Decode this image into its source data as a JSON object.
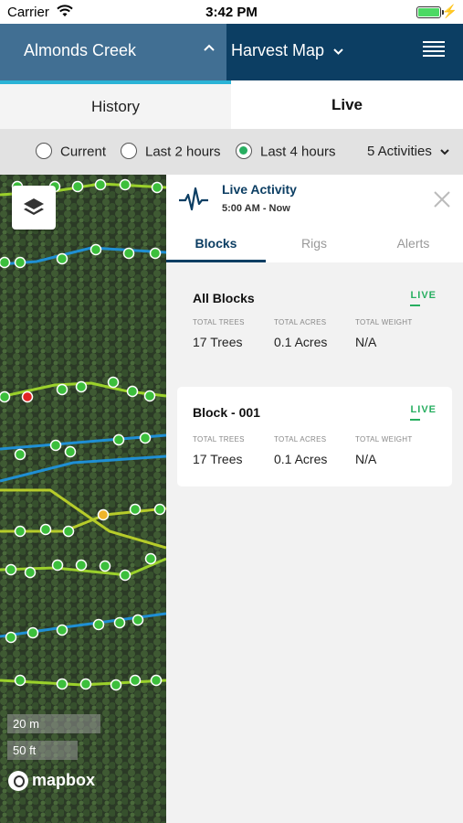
{
  "status": {
    "carrier": "Carrier",
    "time": "3:42 PM"
  },
  "header": {
    "farm": "Almonds Creek",
    "map_type": "Harvest Map"
  },
  "tabs": {
    "history": "History",
    "live": "Live"
  },
  "filters": {
    "options": [
      "Current",
      "Last 2 hours",
      "Last 4 hours"
    ],
    "selected": "Last 4 hours",
    "activities": "5 Activities"
  },
  "map": {
    "scale_m": "20 m",
    "scale_ft": "50 ft",
    "brand": "mapbox"
  },
  "panel": {
    "title": "Live Activity",
    "range": "5:00 AM - Now",
    "subtabs": [
      "Blocks",
      "Rigs",
      "Alerts"
    ],
    "active_subtab": "Blocks",
    "blocks": [
      {
        "name": "All Blocks",
        "status": "LIVE",
        "labels": [
          "TOTAL TREES",
          "TOTAL ACRES",
          "TOTAL WEIGHT"
        ],
        "values": [
          "17 Trees",
          "0.1 Acres",
          "N/A"
        ]
      },
      {
        "name": "Block - 001",
        "status": "LIVE",
        "labels": [
          "TOTAL TREES",
          "TOTAL ACRES",
          "TOTAL WEIGHT"
        ],
        "values": [
          "17 Trees",
          "0.1 Acres",
          "N/A"
        ]
      }
    ]
  },
  "colors": {
    "header": "#0c3e63",
    "farm_bg": "#416f93",
    "accent": "#2ab3d6",
    "live_green": "#27ae60"
  }
}
